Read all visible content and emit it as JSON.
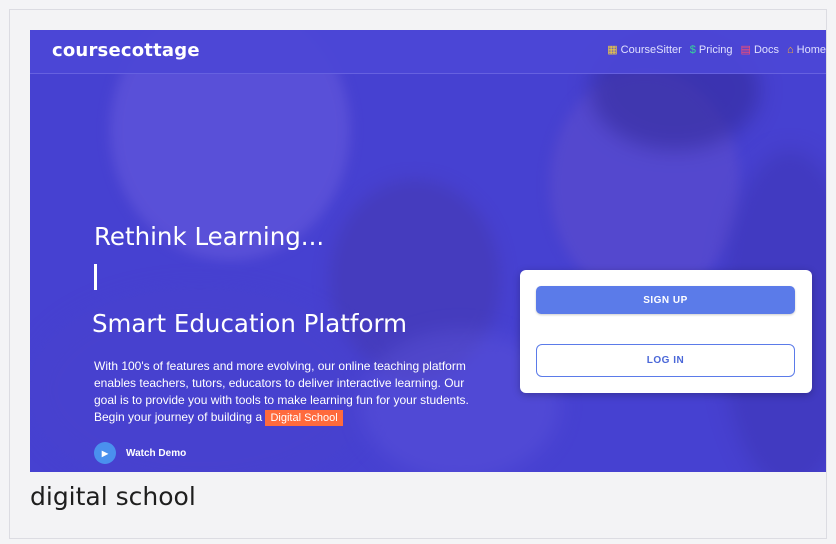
{
  "header": {
    "brand": "coursecottage",
    "nav": [
      {
        "label": "CourseSitter",
        "icon": "monitor-user-icon",
        "color": "#f7d23c"
      },
      {
        "label": "Pricing",
        "icon": "dollar-icon",
        "color": "#36d399"
      },
      {
        "label": "Docs",
        "icon": "book-icon",
        "color": "#ff4d6b"
      },
      {
        "label": "Home",
        "icon": "home-icon",
        "color": "#ffb02e"
      }
    ]
  },
  "hero": {
    "title": "Rethink Learning...",
    "subtitle": "Smart Education Platform",
    "description": "With 100's of features and more evolving, our online teaching platform enables teachers, tutors, educators to deliver interactive learning. Our goal is to provide you with tools to make learning fun for your students. Begin your journey of building a",
    "highlight": "Digital School",
    "watch_demo": "Watch Demo"
  },
  "auth": {
    "signup_label": "SIGN UP",
    "login_label": "LOG IN"
  },
  "caption": "digital school",
  "colors": {
    "hero_bg": "#4a45cf",
    "accent_button": "#5b7be9",
    "highlight_pill": "#ff6a3d"
  }
}
